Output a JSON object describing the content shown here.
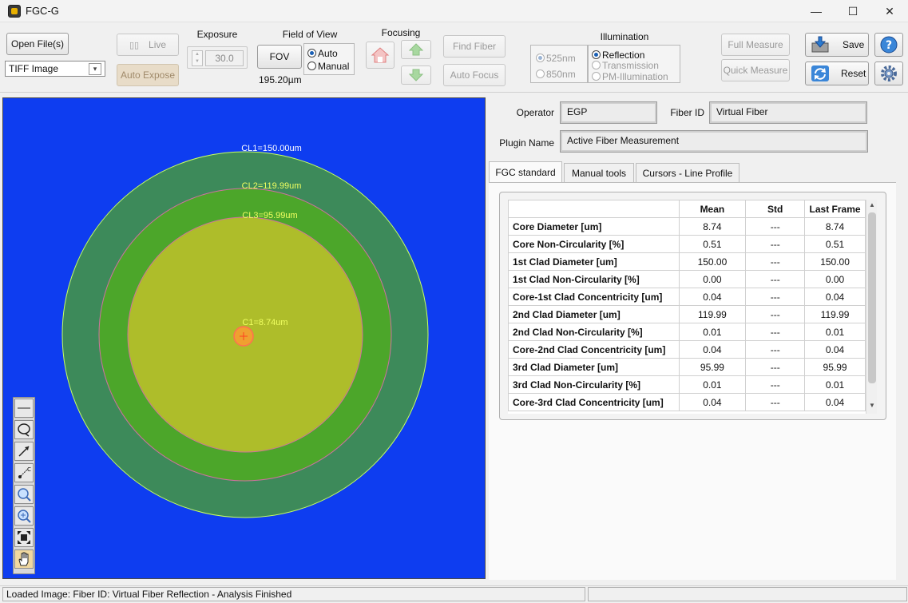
{
  "window": {
    "title": "FGC-G",
    "minimize": "—",
    "maximize": "☐",
    "close": "✕"
  },
  "toolbar": {
    "open_files": "Open File(s)",
    "file_type": "TIFF Image",
    "live": "Live",
    "auto_expose": "Auto Expose",
    "exposure_label": "Exposure",
    "exposure_value": "30.0",
    "fov_label": "Field of View",
    "fov_button": "FOV",
    "fov_auto": "Auto",
    "fov_manual": "Manual",
    "fov_value": "195.20µm",
    "focusing_label": "Focusing",
    "find_fiber": "Find Fiber",
    "auto_focus": "Auto Focus",
    "illumination_label": "Illumination",
    "wl_525": "525nm",
    "wl_850": "850nm",
    "reflection": "Reflection",
    "transmission": "Transmission",
    "pm_illumination": "PM-Illumination",
    "full_measure": "Full Measure",
    "quick_measure": "Quick Measure",
    "save": "Save",
    "reset": "Reset"
  },
  "image": {
    "cl1": "CL1=150.00um",
    "cl2": "CL2=119.99um",
    "cl3": "CL3=95.99um",
    "c1": "C1=8.74um",
    "colors": {
      "background": "#0e3df0",
      "clad1": "#3d8a5a",
      "clad2": "#4ca62a",
      "clad3": "#aebd2a",
      "core": "#f0a030"
    }
  },
  "form": {
    "operator_label": "Operator",
    "operator_value": "EGP",
    "fiber_id_label": "Fiber ID",
    "fiber_id_value": "Virtual Fiber",
    "plugin_label": "Plugin Name",
    "plugin_value": "Active Fiber Measurement"
  },
  "tabs": [
    "FGC standard",
    "Manual tools",
    "Cursors - Line Profile"
  ],
  "table": {
    "headers": [
      "",
      "Mean",
      "Std",
      "Last Frame"
    ],
    "rows": [
      [
        "Core Diameter [um]",
        "8.74",
        "---",
        "8.74"
      ],
      [
        "Core Non-Circularity [%]",
        "0.51",
        "---",
        "0.51"
      ],
      [
        "1st Clad Diameter [um]",
        "150.00",
        "---",
        "150.00"
      ],
      [
        "1st Clad Non-Circularity [%]",
        "0.00",
        "---",
        "0.00"
      ],
      [
        "Core-1st Clad Concentricity [um]",
        "0.04",
        "---",
        "0.04"
      ],
      [
        "2nd Clad Diameter [um]",
        "119.99",
        "---",
        "119.99"
      ],
      [
        "2nd Clad Non-Circularity [%]",
        "0.01",
        "---",
        "0.01"
      ],
      [
        "Core-2nd Clad Concentricity [um]",
        "0.04",
        "---",
        "0.04"
      ],
      [
        "3rd Clad Diameter [um]",
        "95.99",
        "---",
        "95.99"
      ],
      [
        "3rd Clad Non-Circularity [%]",
        "0.01",
        "---",
        "0.01"
      ],
      [
        "Core-3rd Clad Concentricity [um]",
        "0.04",
        "---",
        "0.04"
      ]
    ]
  },
  "status": {
    "message": "Loaded Image: Fiber ID: Virtual Fiber Reflection - Analysis Finished"
  }
}
